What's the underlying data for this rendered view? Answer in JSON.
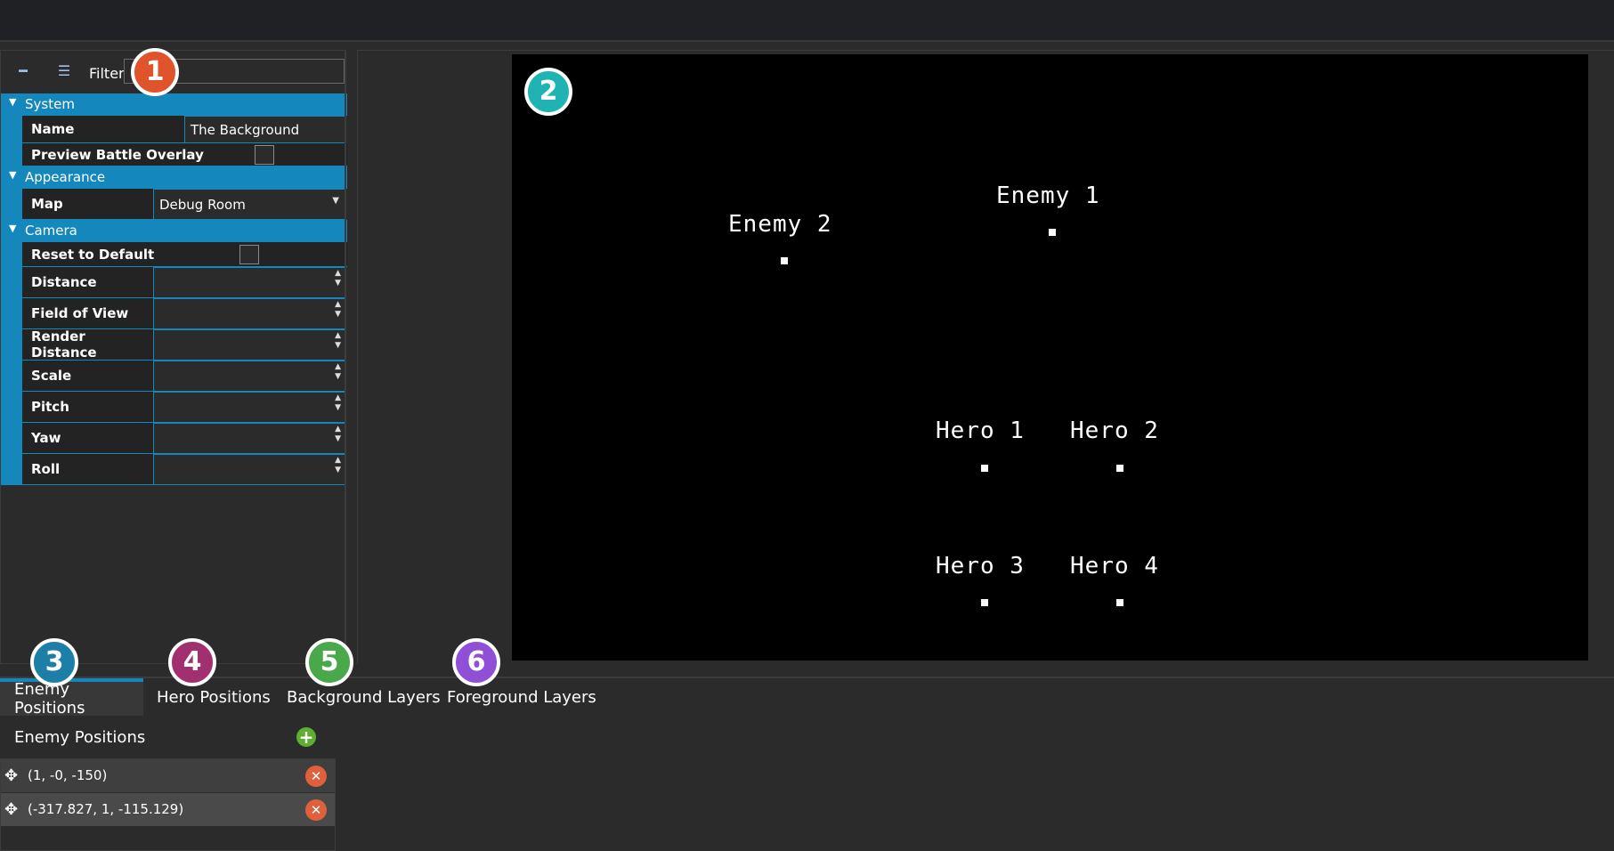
{
  "toolbar": {
    "filter_label": "Filter",
    "filter_value": ""
  },
  "properties": {
    "system": {
      "label": "System",
      "name_label": "Name",
      "name_value": "The Background",
      "preview_label": "Preview Battle Overlay"
    },
    "appearance": {
      "label": "Appearance",
      "map_label": "Map",
      "map_value": "Debug Room"
    },
    "camera": {
      "label": "Camera",
      "reset_label": "Reset to Default",
      "distance_label": "Distance",
      "fov_label": "Field of View",
      "render_distance_label": "Render Distance",
      "scale_label": "Scale",
      "pitch_label": "Pitch",
      "yaw_label": "Yaw",
      "roll_label": "Roll"
    }
  },
  "viewport": {
    "labels": {
      "enemy1": "Enemy 1",
      "enemy2": "Enemy 2",
      "hero1": "Hero 1",
      "hero2": "Hero 2",
      "hero3": "Hero 3",
      "hero4": "Hero 4"
    }
  },
  "tabs": {
    "enemy": "Enemy Positions",
    "hero": "Hero Positions",
    "background": "Background Layers",
    "foreground": "Foreground Layers"
  },
  "enemy_panel": {
    "title": "Enemy Positions",
    "items": [
      "(1, -0, -150)",
      "(-317.827, 1, -115.129)"
    ]
  },
  "badges": {
    "b1": "1",
    "b2": "2",
    "b3": "3",
    "b4": "4",
    "b5": "5",
    "b6": "6"
  },
  "colors": {
    "accent": "#1487bd",
    "badge1": "#e0542c",
    "badge2": "#1fb3b3",
    "badge3": "#1d7fa8",
    "badge4": "#a3306e",
    "badge5": "#49a84a",
    "badge6": "#8f4fd6"
  },
  "icons": {
    "collapse": "minus-icon",
    "categorize": "list-icon",
    "move": "move-icon",
    "add": "plus-icon",
    "delete": "close-icon"
  }
}
